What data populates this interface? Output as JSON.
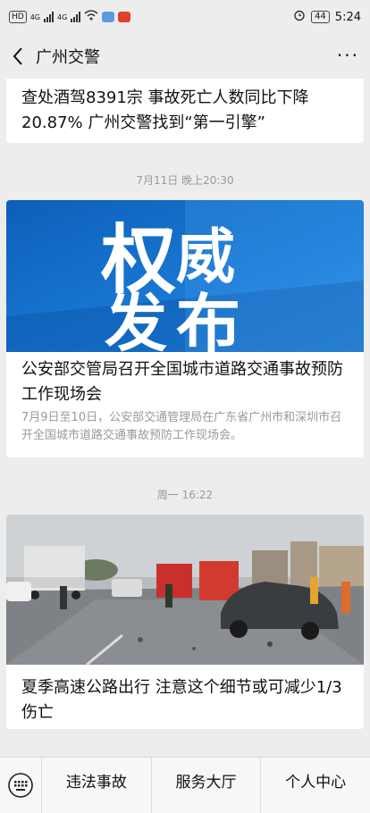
{
  "status": {
    "left_badge": "HD",
    "signal1": "4G",
    "signal2": "4G",
    "battery": "44",
    "time": "5:24"
  },
  "header": {
    "title": "广州交警",
    "more": "···"
  },
  "articles": {
    "top_title": "查处酒驾8391宗 事故死亡人数同比下降20.87% 广州交警找到“第一引擎”",
    "ts1": "7月11日 晚上20:30",
    "a1_banner_chars": [
      "权",
      "威",
      "发",
      "布"
    ],
    "a1_title": "公安部交管局召开全国城市道路交通事故预防工作现场会",
    "a1_desc": "7月9日至10日，公安部交通管理局在广东省广州市和深圳市召开全国城市道路交通事故预防工作现场会。",
    "ts2": "周一 16:22",
    "a2_title": "夏季高速公路出行 注意这个细节或可减少1/3伤亡"
  },
  "bottom": {
    "tabs": [
      "违法事故",
      "服务大厅",
      "个人中心"
    ]
  },
  "colors": {
    "banner_blue": "#1878d2",
    "accent_red": "#e0402c"
  }
}
